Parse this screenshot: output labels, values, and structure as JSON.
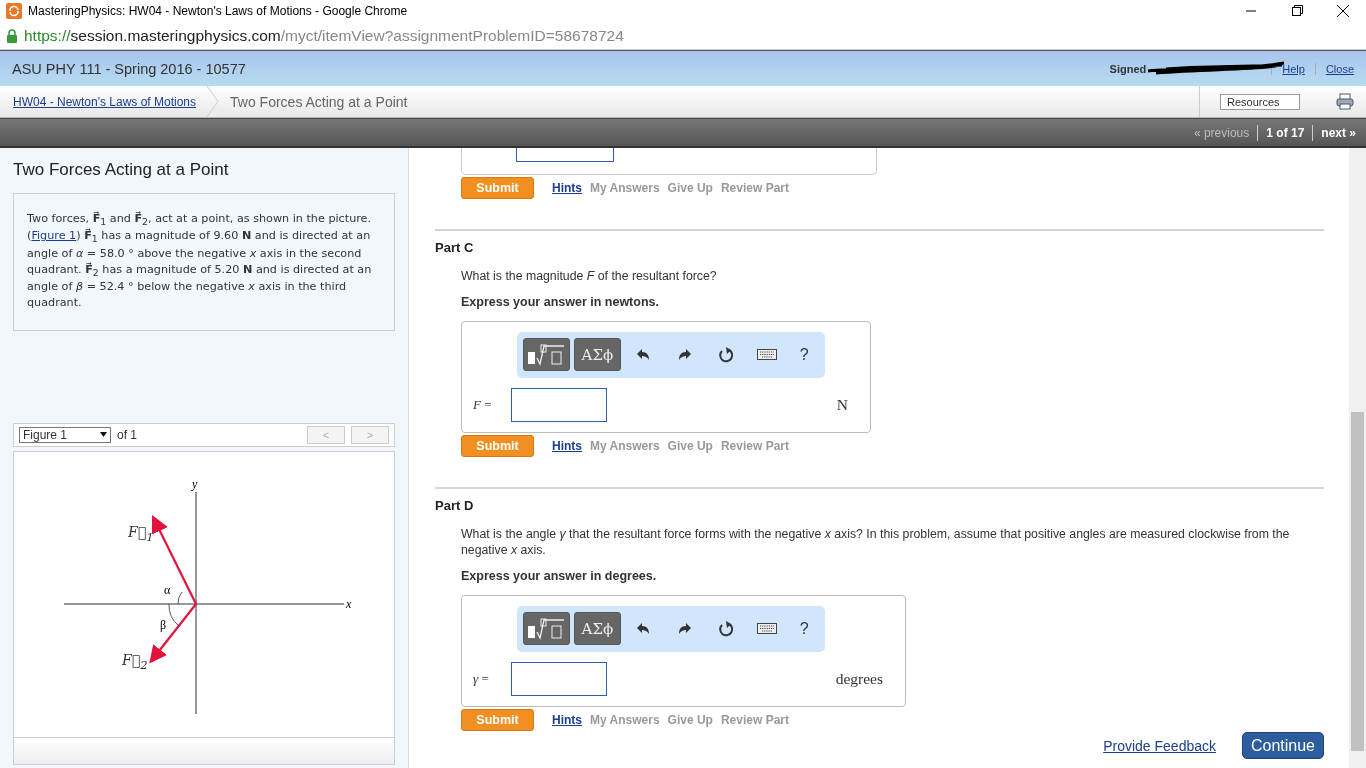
{
  "window": {
    "title": "MasteringPhysics: HW04 - Newton's Laws of Motions - Google Chrome"
  },
  "address_bar": {
    "scheme": "https://",
    "host": "session.masteringphysics.com",
    "path": "/myct/itemView?assignmentProblemID=58678724"
  },
  "course_bar": {
    "title": "ASU PHY 111 - Spring 2016 - 10577",
    "signed_in": "Signed",
    "links": [
      "Help",
      "Close"
    ]
  },
  "breadcrumb": {
    "items": [
      "HW04 - Newton's Laws of Motions",
      "Two Forces Acting at a Point"
    ],
    "resources": "Resources"
  },
  "pager": {
    "previous": "« previous",
    "position": "1 of 17",
    "next": "next »"
  },
  "problem": {
    "title": "Two Forces Acting at a Point",
    "intro": "Two forces, **F⃗**$_{1}$ and **F⃗**$_{2}$, act at a point, as shown in the picture. (",
    "figure_link": "Figure 1",
    "intro_rest": ") **F⃗**$_{1}$ has a magnitude of 9.60 **N** and is directed at an angle of *α* = 58.0 ° above the negative *x* axis in the second quadrant. **F⃗**$_{2}$ has a magnitude of 5.20 **N** and is directed at an angle of *β* = 52.4 ° below the negative *x* axis in the third quadrant."
  },
  "figure": {
    "selector": "Figure 1",
    "count": "of 1",
    "prev": "<",
    "next": ">",
    "labels": {
      "y": "y",
      "x": "x",
      "alpha": "α",
      "beta": "β",
      "f1": "F⃗$_{1}$",
      "f2": "F⃗$_{2}$"
    }
  },
  "parts": [
    {
      "kind": "tail",
      "actions": [
        {
          "label": "Submit",
          "kind": "submit",
          "disabled": false
        },
        {
          "label": "Hints",
          "kind": "link",
          "disabled": false
        },
        {
          "label": "My Answers",
          "kind": "link",
          "disabled": true
        },
        {
          "label": "Give Up",
          "kind": "link",
          "disabled": true
        },
        {
          "label": "Review Part",
          "kind": "link",
          "disabled": true
        }
      ]
    },
    {
      "kind": "full",
      "title": "Part C",
      "question": "What is the magnitude *F* of the resultant force?",
      "instruction": "Express your answer in newtons.",
      "toolbar": [
        "ΑΣϕ",
        "?"
      ],
      "variable": "*F* =",
      "unit": "N",
      "actions": [
        {
          "label": "Submit",
          "kind": "submit",
          "disabled": false
        },
        {
          "label": "Hints",
          "kind": "link",
          "disabled": false
        },
        {
          "label": "My Answers",
          "kind": "link",
          "disabled": true
        },
        {
          "label": "Give Up",
          "kind": "link",
          "disabled": true
        },
        {
          "label": "Review Part",
          "kind": "link",
          "disabled": true
        }
      ]
    },
    {
      "kind": "full",
      "title": "Part D",
      "question": "What is the angle *γ* that the resultant force forms with the negative *x* axis? In this problem, assume that positive angles are measured clockwise from the negative *x* axis.",
      "instruction": "Express your answer in degrees.",
      "toolbar": [
        "ΑΣϕ",
        "?"
      ],
      "variable": "*γ* =",
      "unit": "degrees",
      "actions": [
        {
          "label": "Submit",
          "kind": "submit",
          "disabled": false
        },
        {
          "label": "Hints",
          "kind": "link",
          "disabled": false
        },
        {
          "label": "My Answers",
          "kind": "link",
          "disabled": true
        },
        {
          "label": "Give Up",
          "kind": "link",
          "disabled": true
        },
        {
          "label": "Review Part",
          "kind": "link",
          "disabled": true
        }
      ]
    }
  ],
  "footer": {
    "feedback": "Provide Feedback",
    "continue": "Continue"
  }
}
